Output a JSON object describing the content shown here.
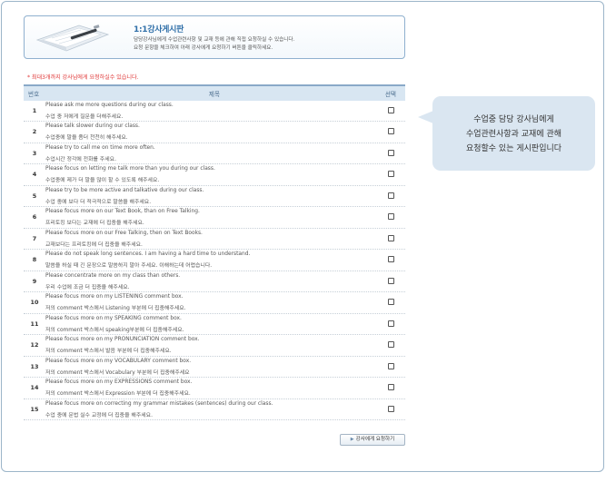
{
  "banner": {
    "title": "1:1강사게시판",
    "desc_line1": "담당강사님에게 수업관련사항 및 교재 등에 관해 직접 요청하실 수 있습니다.",
    "desc_line2": "요청 문항을 체크하여 아래 강사에게 요청하기 버튼을 클릭하세요."
  },
  "notice": "* 최대3개까지 강사님에게 요청하실수 있습니다.",
  "table": {
    "headers": {
      "no": "번호",
      "title": "제목",
      "select": "선택"
    },
    "rows": [
      {
        "no": "1",
        "en": "Please ask me more questions during our class.",
        "ko": "수업 중 저에게 질문을 더해주세요."
      },
      {
        "no": "2",
        "en": "Please talk slower during our class.",
        "ko": "수업중에 말을 좀더 천천히 해주세요."
      },
      {
        "no": "3",
        "en": "Please try to call me on time more often.",
        "ko": "수업시간 정각에 전화를 주세요."
      },
      {
        "no": "4",
        "en": "Please focus on letting me talk more than you during our class.",
        "ko": "수업중에 제가 더 말을 많이 할 수 있도록 해주세요."
      },
      {
        "no": "5",
        "en": "Please try to be more active and talkative during our class.",
        "ko": "수업 중에 보다 더 적극적으로 말씀을 해주세요."
      },
      {
        "no": "6",
        "en": "Please focus more on our Text Book, than on Free Talking.",
        "ko": "프리토킹 보다는 교재에 더 집중을 해주세요."
      },
      {
        "no": "7",
        "en": "Please focus more on our Free Talking, then on Text Books.",
        "ko": "교재보다는 프리토킹에 더 집중을 해주세요."
      },
      {
        "no": "8",
        "en": "Please do not speak long sentences. I am having a hard time to understand.",
        "ko": "말씀을 하실 때 긴 문장으로 말씀하지 말아 주세요. 이해하는데 어렵습니다."
      },
      {
        "no": "9",
        "en": "Please concentrate more on my class than others.",
        "ko": "우리 수업에 조금 더 집중을 해주세요."
      },
      {
        "no": "10",
        "en": "Please focus more on my LISTENING comment box.",
        "ko": "저의 comment 박스에서 Listening 부분에 더 집중해주세요."
      },
      {
        "no": "11",
        "en": "Please focus more on my SPEAKING comment box.",
        "ko": "저의 comment 박스에서 speaking부분에 더 집중해주세요."
      },
      {
        "no": "12",
        "en": "Please focus more on my PRONUNCIATION comment box.",
        "ko": "저의 comment 박스에서 발음 부분에 더 집중해주세요."
      },
      {
        "no": "13",
        "en": "Please focus more on my VOCABULARY comment box.",
        "ko": "저의 comment 박스에서 Vocabulary 부분에 더 집중해주세요"
      },
      {
        "no": "14",
        "en": "Please focus more on my EXPRESSIONS comment box.",
        "ko": "저의 comment 박스에서 Expression 부분에 더 집중해주세요."
      },
      {
        "no": "15",
        "en": "Please focus more on correcting my grammar mistakes (sentences) during our class.",
        "ko": "수업 중에 문법 실수 교정에 더 집중을 해주세요."
      }
    ]
  },
  "request_button": "강사에게 요청하기",
  "bubble": {
    "line1": "수업중 담당 강사님에게",
    "line2": "수업관련사항과 교재에 관해",
    "line3": "요청할수 있는 게시판입니다"
  },
  "colors": {
    "accent": "#2f6fa8",
    "notice": "#e03a3a",
    "header_bg": "#d8e6f2",
    "bubble_bg": "#dae6f1"
  }
}
